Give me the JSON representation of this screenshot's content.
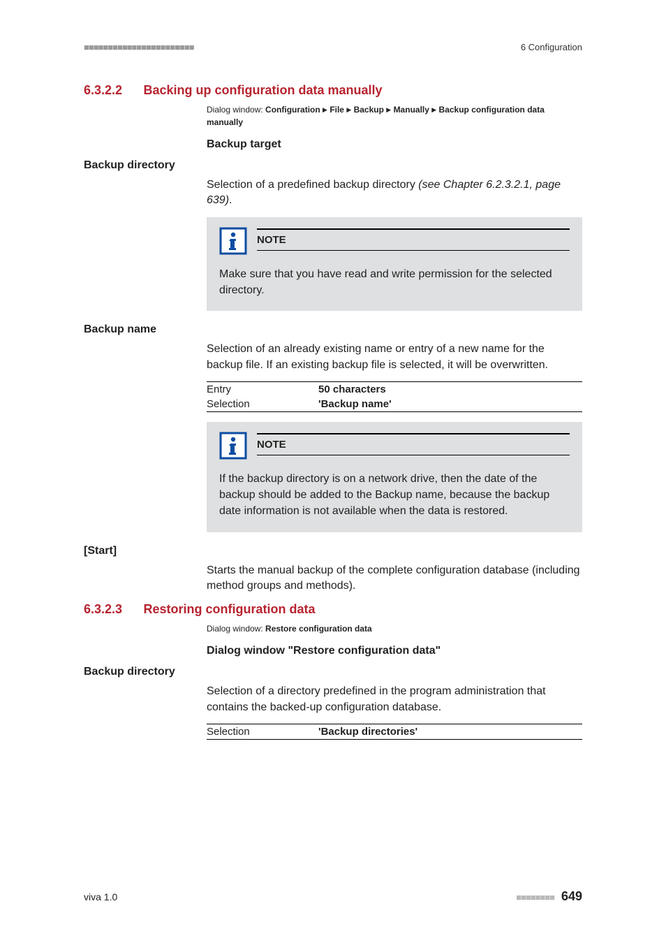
{
  "header": {
    "ticks": "■■■■■■■■■■■■■■■■■■■■■■■",
    "right": "6 Configuration"
  },
  "section1": {
    "number": "6.3.2.2",
    "title": "Backing up configuration data manually",
    "dialog": {
      "label": "Dialog window: ",
      "path": [
        "Configuration",
        "File",
        "Backup",
        "Manually",
        "Backup configuration data manually"
      ]
    },
    "subheading": "Backup target",
    "field_backup_directory": {
      "label": "Backup directory",
      "text_prefix": "Selection of a predefined backup directory ",
      "text_italic": "(see Chapter 6.2.3.2.1, page 639)",
      "text_suffix": "."
    },
    "note1": {
      "title": "NOTE",
      "body": "Make sure that you have read and write permission for the selected directory."
    },
    "field_backup_name": {
      "label": "Backup name",
      "text": "Selection of an already existing name or entry of a new name for the backup file. If an existing backup file is selected, it will be overwritten.",
      "rows": [
        {
          "k": "Entry",
          "v": "50 characters"
        },
        {
          "k": "Selection",
          "v": "'Backup name'"
        }
      ]
    },
    "note2": {
      "title": "NOTE",
      "body_prefix": "If the backup directory is on a network drive, then the date of the backup should be added to the ",
      "body_bold": "Backup name",
      "body_suffix": ", because the backup date information is not available when the data is restored."
    },
    "field_start": {
      "label": "[Start]",
      "text": "Starts the manual backup of the complete configuration database (including method groups and methods)."
    }
  },
  "section2": {
    "number": "6.3.2.3",
    "title": "Restoring configuration data",
    "dialog": {
      "label": "Dialog window: ",
      "bold": "Restore configuration data"
    },
    "subheading": "Dialog window \"Restore configuration data\"",
    "field_backup_directory": {
      "label": "Backup directory",
      "text": "Selection of a directory predefined in the program administration that contains the backed-up configuration database.",
      "rows": [
        {
          "k": "Selection",
          "v": "'Backup directories'"
        }
      ]
    }
  },
  "footer": {
    "left": "viva 1.0",
    "ticks": "■■■■■■■■",
    "page": "649"
  }
}
